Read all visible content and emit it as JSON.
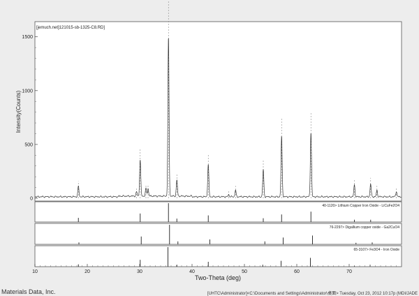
{
  "chart_data": {
    "type": "line",
    "title": "[jemuch.net]121015-sb-1325-C8.RD]",
    "xlabel": "Two-Theta (deg)",
    "ylabel": "Intensity(Counts)",
    "xlim": [
      10,
      80
    ],
    "ylim": [
      0,
      1550
    ],
    "x_ticks": [
      "10",
      "20",
      "30",
      "40",
      "50",
      "60",
      "70"
    ],
    "y_ticks": [
      "0",
      "500",
      "1000",
      "1500"
    ],
    "grid": false,
    "peaks": [
      {
        "x": 18.3,
        "y": 95
      },
      {
        "x": 29.4,
        "y": 40
      },
      {
        "x": 30.1,
        "y": 340
      },
      {
        "x": 31.2,
        "y": 70
      },
      {
        "x": 31.6,
        "y": 70
      },
      {
        "x": 35.5,
        "y": 1480
      },
      {
        "x": 37.1,
        "y": 150
      },
      {
        "x": 43.1,
        "y": 300
      },
      {
        "x": 47.0,
        "y": 20
      },
      {
        "x": 48.3,
        "y": 60
      },
      {
        "x": 53.6,
        "y": 250
      },
      {
        "x": 57.1,
        "y": 560
      },
      {
        "x": 62.7,
        "y": 600
      },
      {
        "x": 71.0,
        "y": 110
      },
      {
        "x": 74.1,
        "y": 120
      },
      {
        "x": 75.3,
        "y": 60
      },
      {
        "x": 79.0,
        "y": 50
      }
    ],
    "reference_patterns": [
      {
        "label": "40-1120> Lithium Copper Iron Oxide - LiCuFe2O4",
        "lines": [
          {
            "x": 18.3,
            "h": 0.22
          },
          {
            "x": 30.1,
            "h": 0.45
          },
          {
            "x": 35.5,
            "h": 1.0
          },
          {
            "x": 37.1,
            "h": 0.18
          },
          {
            "x": 43.1,
            "h": 0.35
          },
          {
            "x": 53.6,
            "h": 0.2
          },
          {
            "x": 57.1,
            "h": 0.4
          },
          {
            "x": 62.7,
            "h": 0.55
          },
          {
            "x": 71.0,
            "h": 0.12
          },
          {
            "x": 74.1,
            "h": 0.12
          }
        ]
      },
      {
        "label": "76-2297> Digallium copper oxide - Ga2CuO4",
        "lines": [
          {
            "x": 18.4,
            "h": 0.1
          },
          {
            "x": 30.3,
            "h": 0.4
          },
          {
            "x": 35.7,
            "h": 1.0
          },
          {
            "x": 37.3,
            "h": 0.15
          },
          {
            "x": 43.4,
            "h": 0.25
          },
          {
            "x": 53.9,
            "h": 0.15
          },
          {
            "x": 57.4,
            "h": 0.35
          },
          {
            "x": 63.0,
            "h": 0.45
          },
          {
            "x": 71.3,
            "h": 0.08
          },
          {
            "x": 74.4,
            "h": 0.1
          }
        ]
      },
      {
        "label": "65-3107> Fe3O4 - Iron Oxide",
        "lines": [
          {
            "x": 18.3,
            "h": 0.12
          },
          {
            "x": 30.1,
            "h": 0.35
          },
          {
            "x": 35.4,
            "h": 1.0
          },
          {
            "x": 37.1,
            "h": 0.1
          },
          {
            "x": 43.1,
            "h": 0.25
          },
          {
            "x": 53.5,
            "h": 0.1
          },
          {
            "x": 57.0,
            "h": 0.3
          },
          {
            "x": 62.6,
            "h": 0.45
          },
          {
            "x": 71.0,
            "h": 0.05
          },
          {
            "x": 74.0,
            "h": 0.1
          }
        ]
      }
    ]
  },
  "footer": {
    "company": "Materials Data, Inc.",
    "status": "[UHTC\\Administrator]<C:\\Documents and Settings\\Administrator\\桌面> Tuesday, Oct 23, 2012 10:17p (MDI/JADE"
  }
}
